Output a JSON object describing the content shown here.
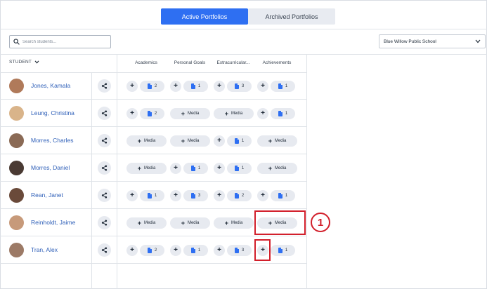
{
  "tabs": {
    "active_label": "Active Portfolios",
    "archived_label": "Archived Portfolios"
  },
  "search": {
    "placeholder": "Search students..."
  },
  "school_select": {
    "selected": "Blue Willow Public School"
  },
  "table": {
    "student_header": "STUDENT",
    "columns": [
      "Academics",
      "Personal Goals",
      "Extracurricular...",
      "Achievements"
    ],
    "media_label": "Media",
    "rows": [
      {
        "name": "Jones, Kamala",
        "cells": [
          {
            "type": "count",
            "value": "2"
          },
          {
            "type": "count",
            "value": "1"
          },
          {
            "type": "count",
            "value": "3"
          },
          {
            "type": "count",
            "value": "1"
          }
        ]
      },
      {
        "name": "Leung, Christina",
        "cells": [
          {
            "type": "count",
            "value": "2"
          },
          {
            "type": "media"
          },
          {
            "type": "media"
          },
          {
            "type": "count",
            "value": "1"
          }
        ]
      },
      {
        "name": "Morres, Charles",
        "cells": [
          {
            "type": "media"
          },
          {
            "type": "media"
          },
          {
            "type": "count",
            "value": "1"
          },
          {
            "type": "media"
          }
        ]
      },
      {
        "name": "Morres, Daniel",
        "cells": [
          {
            "type": "media"
          },
          {
            "type": "count",
            "value": "1"
          },
          {
            "type": "count",
            "value": "1"
          },
          {
            "type": "media"
          }
        ]
      },
      {
        "name": "Rean, Janet",
        "cells": [
          {
            "type": "count",
            "value": "1"
          },
          {
            "type": "count",
            "value": "3"
          },
          {
            "type": "count",
            "value": "2"
          },
          {
            "type": "count",
            "value": "1"
          }
        ]
      },
      {
        "name": "Reinholdt, Jaime",
        "cells": [
          {
            "type": "media"
          },
          {
            "type": "media"
          },
          {
            "type": "media"
          },
          {
            "type": "media"
          }
        ]
      },
      {
        "name": "Tran, Alex",
        "cells": [
          {
            "type": "count",
            "value": "2"
          },
          {
            "type": "count",
            "value": "1"
          },
          {
            "type": "count",
            "value": "3"
          },
          {
            "type": "count",
            "value": "1"
          }
        ]
      }
    ]
  },
  "annotation": {
    "callout_number": "1",
    "color": "#d21f2b"
  },
  "colors": {
    "accent": "#2e6ff2",
    "link": "#2e5fb8",
    "pill": "#e7eaf0"
  },
  "avatar_colors": [
    "#b07a5a",
    "#d9b48a",
    "#8a6a55",
    "#4a3a33",
    "#6a4a3a",
    "#c79a7a",
    "#9c7a66"
  ]
}
